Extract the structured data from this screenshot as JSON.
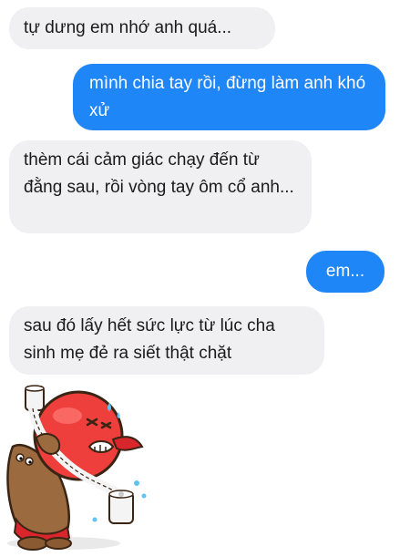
{
  "messages": [
    {
      "id": "msg1",
      "direction": "incoming",
      "text": "tự dưng em nhớ anh quá..."
    },
    {
      "id": "msg2",
      "direction": "outgoing",
      "text": "mình chia tay rồi, đừng làm anh khó xử"
    },
    {
      "id": "msg3",
      "direction": "incoming",
      "text": "thèm cái cảm giác chạy đến từ đằng sau, rồi vòng tay ôm cổ anh..."
    },
    {
      "id": "msg4",
      "direction": "outgoing",
      "text": "em..."
    },
    {
      "id": "msg5",
      "direction": "incoming",
      "text": "sau đó lấy hết sức lực từ lúc cha sinh mẹ đẻ ra siết thật chặt"
    }
  ],
  "sticker": {
    "icon": "cartoon-strangling-sticker-icon"
  },
  "colors": {
    "incoming_bubble": "#f0f0f2",
    "outgoing_bubble": "#1f86f8",
    "outgoing_text": "#ffffff",
    "incoming_text": "#1a1a1a"
  }
}
